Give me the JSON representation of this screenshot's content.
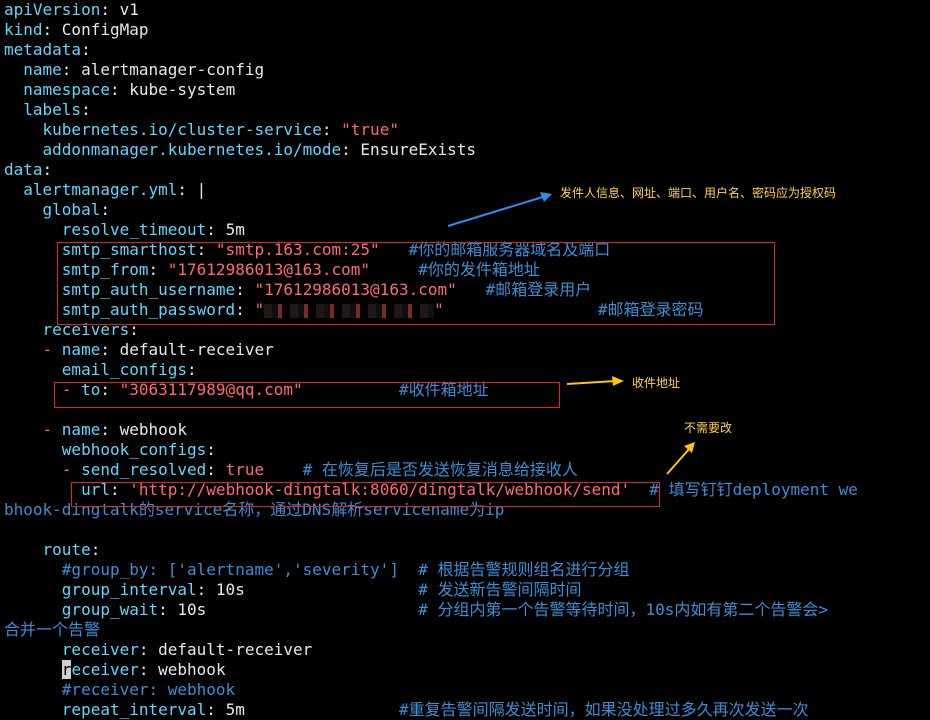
{
  "lines": {
    "l1_key": "apiVersion",
    "l1_val": "v1",
    "l2_key": "kind",
    "l2_val": "ConfigMap",
    "l3_key": "metadata",
    "l4_key": "name",
    "l4_val": "alertmanager-config",
    "l5_key": "namespace",
    "l5_val": "kube-system",
    "l6_key": "labels",
    "l7_key": "kubernetes.io/cluster-service",
    "l7_val": "\"true\"",
    "l8_key": "addonmanager.kubernetes.io/mode",
    "l8_val": "EnsureExists",
    "l9_key": "data",
    "l10_key": "alertmanager.yml",
    "l10_val": "|",
    "l11_key": "global",
    "l12_key": "resolve_timeout",
    "l12_val": "5m",
    "l13_key": "smtp_smarthost",
    "l13_val": "\"smtp.163.com:25\"",
    "l13_cmt": "#你的邮箱服务器域名及端口",
    "l14_key": "smtp_from",
    "l14_val": "\"17612986013@163.com\"",
    "l14_cmt": "#你的发件箱地址",
    "l15_key": "smtp_auth_username",
    "l15_val": "\"17612986013@163.com\"",
    "l15_cmt": "#邮箱登录用户",
    "l16_key": "smtp_auth_password",
    "l16_val_start": "\"",
    "l16_val_end": "\"",
    "l16_cmt": "#邮箱登录密码",
    "l17_key": "receivers",
    "l18_dash": "- ",
    "l18_key": "name",
    "l18_val": "default-receiver",
    "l19_key": "email_configs",
    "l20_dash": "- ",
    "l20_key": "to",
    "l20_val": "\"3063117989@qq.com\"",
    "l20_cmt": "#收件箱地址",
    "l22_dash": "- ",
    "l22_key": "name",
    "l22_val": "webhook",
    "l23_key": "webhook_configs",
    "l24_dash": "- ",
    "l24_key": "send_resolved",
    "l24_val": "true",
    "l24_cmt": "# 在恢复后是否发送恢复消息给接收人",
    "l25_key": "url",
    "l25_val": "'http://webhook-dingtalk:8060/dingtalk/webhook/send'",
    "l25_cmt": "# 填写钉钉deployment we",
    "l26_cmt": "bhook-dingtalk的service名称，通过DNS解析servicename为ip",
    "l28_key": "route",
    "l29_cmt": "#group_by: ['alertname','severity']",
    "l29_cmt2": "# 根据告警规则组名进行分组",
    "l30_key": "group_interval",
    "l30_val": "10s",
    "l30_cmt": "# 发送新告警间隔时间",
    "l31_key": "group_wait",
    "l31_val": "10s",
    "l31_cmt": "# 分组内第一个告警等待时间，10s内如有第二个告警会>",
    "l32_cmt": "合并一个告警",
    "l33_key": "receiver",
    "l33_val": "default-receiver",
    "l34_cursor": "r",
    "l34_key": "eceiver",
    "l34_val": "webhook",
    "l35_cmt": "#receiver: webhook",
    "l36_key": "repeat_interval",
    "l36_val": "5m",
    "l36_cmt": "#重复告警间隔发送时间，如果没处理过多久再次发送一次"
  },
  "annotations": {
    "sender_note": "发件人信息、网址、端口、用户名、密码应为授权码",
    "recipient_note": "收件地址",
    "no_change_note": "不需要改"
  },
  "colors": {
    "key": "#5fd7ff",
    "string": "#ff6b6b",
    "comment": "#3a8fd6",
    "box": "#e02424",
    "note": "#ffd34d",
    "arrow_blue": "#2d8ef0",
    "arrow_yellow": "#ffc21a"
  }
}
